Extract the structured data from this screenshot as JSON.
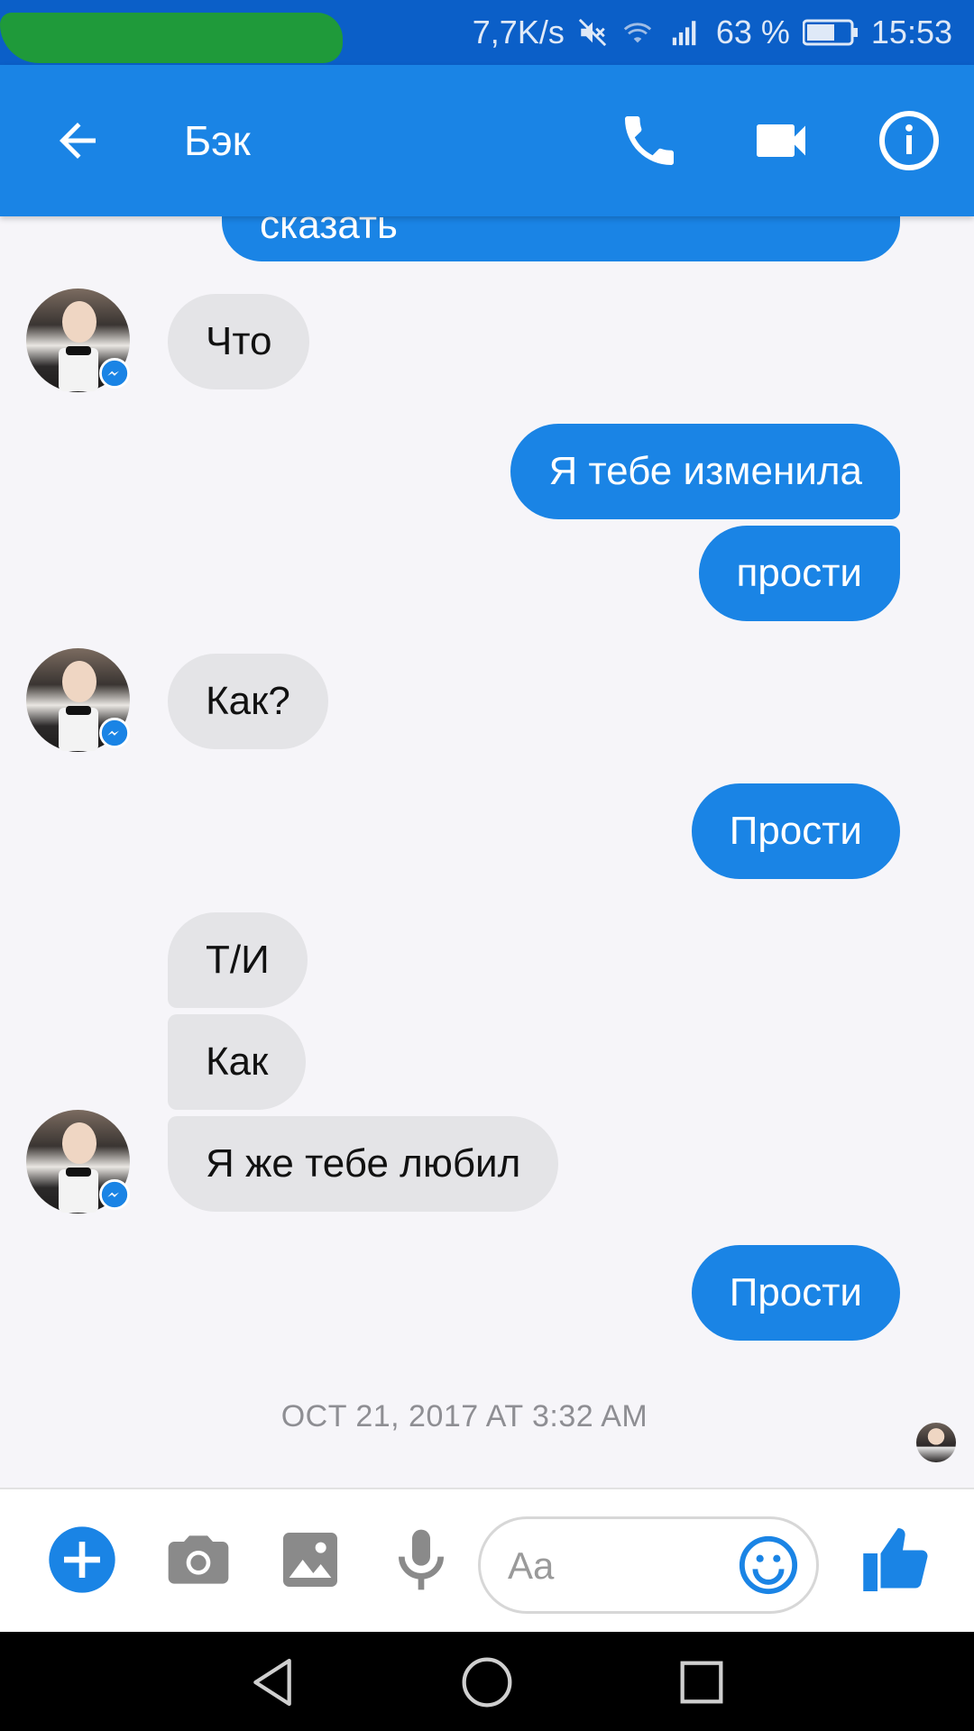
{
  "status_bar": {
    "net_speed": "7,7K/s",
    "battery": "63 %",
    "time": "15:53"
  },
  "header": {
    "title": "Бэк"
  },
  "messages": [
    {
      "side": "out",
      "text": "сказать"
    },
    {
      "side": "in",
      "text": "Что"
    },
    {
      "side": "out",
      "text": "Я тебе изменила"
    },
    {
      "side": "out",
      "text": "прости"
    },
    {
      "side": "in",
      "text": "Как?"
    },
    {
      "side": "out",
      "text": "Прости"
    },
    {
      "side": "in",
      "text": "Т/И"
    },
    {
      "side": "in",
      "text": "Как"
    },
    {
      "side": "in",
      "text": "Я же тебе любил"
    },
    {
      "side": "out",
      "text": "Прости"
    }
  ],
  "timestamp": "OCT 21, 2017 AT 3:32 AM",
  "composer": {
    "placeholder": "Aa"
  },
  "colors": {
    "accent": "#1a84e5",
    "status_bar": "#0b5fc8",
    "incoming_bubble": "#e4e4e7",
    "background": "#f6f5f9"
  },
  "icons": {
    "back": "arrow-left-icon",
    "call": "phone-icon",
    "video": "video-camera-icon",
    "info": "info-icon",
    "more": "plus-icon",
    "camera": "camera-icon",
    "gallery": "image-icon",
    "voice": "microphone-icon",
    "emoji": "smiley-icon",
    "like": "thumbs-up-icon"
  }
}
